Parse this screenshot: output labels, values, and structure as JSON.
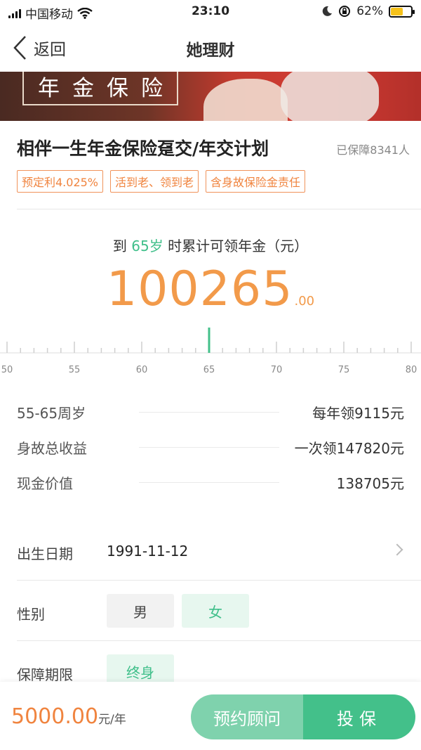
{
  "status_bar": {
    "carrier": "中国移动",
    "time": "23:10",
    "battery": "62%",
    "battery_level": 0.62
  },
  "nav": {
    "back_label": "返回",
    "title": "她理财"
  },
  "banner": {
    "text": "年金保险"
  },
  "product": {
    "title": "相伴一生年金保险趸交/年交计划",
    "covered": "已保障8341人",
    "tags": [
      "预定利4.025%",
      "活到老、领到老",
      "含身故保险金责任"
    ]
  },
  "annuity": {
    "prefix": "到",
    "age": "65岁",
    "suffix": "时累计可领年金（元）",
    "amount_int": "100265",
    "amount_dec": ".00"
  },
  "ruler": {
    "min": 50,
    "max": 80,
    "labels": [
      "50",
      "55",
      "60",
      "65",
      "70",
      "75",
      "80"
    ],
    "selected": 65
  },
  "summary": [
    {
      "label": "55-65周岁",
      "value": "每年领9115元"
    },
    {
      "label": "身故总收益",
      "value": "一次领147820元"
    },
    {
      "label": "现金价值",
      "value": "138705元"
    }
  ],
  "form": {
    "birth_label": "出生日期",
    "birth_value": "1991-11-12",
    "gender_label": "性别",
    "gender_male": "男",
    "gender_female": "女",
    "term_label": "保障期限",
    "term_value": "终身"
  },
  "footer": {
    "price": "5000.00",
    "unit": "元/年",
    "consult_label": "预约顾问",
    "buy_label": "投保"
  },
  "colors": {
    "accent_green": "#43c08a",
    "accent_orange": "#f0843f"
  }
}
